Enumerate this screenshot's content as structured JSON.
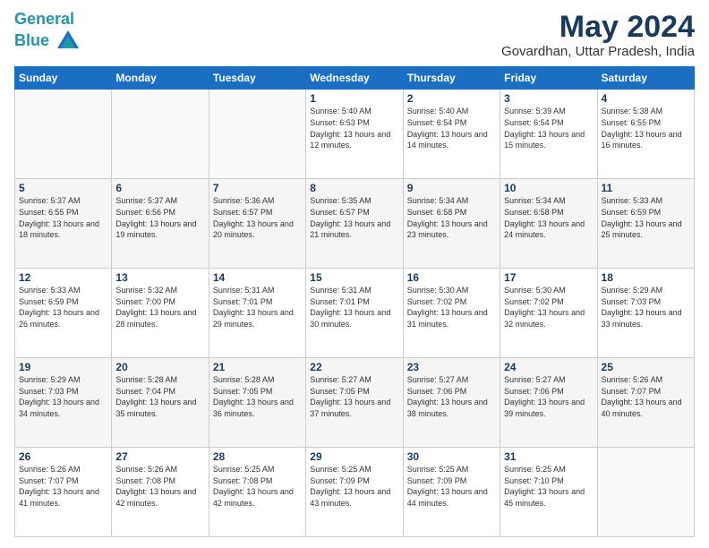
{
  "header": {
    "logo_line1": "General",
    "logo_line2": "Blue",
    "title": "May 2024",
    "subtitle": "Govardhan, Uttar Pradesh, India"
  },
  "weekdays": [
    "Sunday",
    "Monday",
    "Tuesday",
    "Wednesday",
    "Thursday",
    "Friday",
    "Saturday"
  ],
  "weeks": [
    [
      {
        "day": "",
        "info": ""
      },
      {
        "day": "",
        "info": ""
      },
      {
        "day": "",
        "info": ""
      },
      {
        "day": "1",
        "info": "Sunrise: 5:40 AM\nSunset: 6:53 PM\nDaylight: 13 hours and 12 minutes."
      },
      {
        "day": "2",
        "info": "Sunrise: 5:40 AM\nSunset: 6:54 PM\nDaylight: 13 hours and 14 minutes."
      },
      {
        "day": "3",
        "info": "Sunrise: 5:39 AM\nSunset: 6:54 PM\nDaylight: 13 hours and 15 minutes."
      },
      {
        "day": "4",
        "info": "Sunrise: 5:38 AM\nSunset: 6:55 PM\nDaylight: 13 hours and 16 minutes."
      }
    ],
    [
      {
        "day": "5",
        "info": "Sunrise: 5:37 AM\nSunset: 6:55 PM\nDaylight: 13 hours and 18 minutes."
      },
      {
        "day": "6",
        "info": "Sunrise: 5:37 AM\nSunset: 6:56 PM\nDaylight: 13 hours and 19 minutes."
      },
      {
        "day": "7",
        "info": "Sunrise: 5:36 AM\nSunset: 6:57 PM\nDaylight: 13 hours and 20 minutes."
      },
      {
        "day": "8",
        "info": "Sunrise: 5:35 AM\nSunset: 6:57 PM\nDaylight: 13 hours and 21 minutes."
      },
      {
        "day": "9",
        "info": "Sunrise: 5:34 AM\nSunset: 6:58 PM\nDaylight: 13 hours and 23 minutes."
      },
      {
        "day": "10",
        "info": "Sunrise: 5:34 AM\nSunset: 6:58 PM\nDaylight: 13 hours and 24 minutes."
      },
      {
        "day": "11",
        "info": "Sunrise: 5:33 AM\nSunset: 6:59 PM\nDaylight: 13 hours and 25 minutes."
      }
    ],
    [
      {
        "day": "12",
        "info": "Sunrise: 5:33 AM\nSunset: 6:59 PM\nDaylight: 13 hours and 26 minutes."
      },
      {
        "day": "13",
        "info": "Sunrise: 5:32 AM\nSunset: 7:00 PM\nDaylight: 13 hours and 28 minutes."
      },
      {
        "day": "14",
        "info": "Sunrise: 5:31 AM\nSunset: 7:01 PM\nDaylight: 13 hours and 29 minutes."
      },
      {
        "day": "15",
        "info": "Sunrise: 5:31 AM\nSunset: 7:01 PM\nDaylight: 13 hours and 30 minutes."
      },
      {
        "day": "16",
        "info": "Sunrise: 5:30 AM\nSunset: 7:02 PM\nDaylight: 13 hours and 31 minutes."
      },
      {
        "day": "17",
        "info": "Sunrise: 5:30 AM\nSunset: 7:02 PM\nDaylight: 13 hours and 32 minutes."
      },
      {
        "day": "18",
        "info": "Sunrise: 5:29 AM\nSunset: 7:03 PM\nDaylight: 13 hours and 33 minutes."
      }
    ],
    [
      {
        "day": "19",
        "info": "Sunrise: 5:29 AM\nSunset: 7:03 PM\nDaylight: 13 hours and 34 minutes."
      },
      {
        "day": "20",
        "info": "Sunrise: 5:28 AM\nSunset: 7:04 PM\nDaylight: 13 hours and 35 minutes."
      },
      {
        "day": "21",
        "info": "Sunrise: 5:28 AM\nSunset: 7:05 PM\nDaylight: 13 hours and 36 minutes."
      },
      {
        "day": "22",
        "info": "Sunrise: 5:27 AM\nSunset: 7:05 PM\nDaylight: 13 hours and 37 minutes."
      },
      {
        "day": "23",
        "info": "Sunrise: 5:27 AM\nSunset: 7:06 PM\nDaylight: 13 hours and 38 minutes."
      },
      {
        "day": "24",
        "info": "Sunrise: 5:27 AM\nSunset: 7:06 PM\nDaylight: 13 hours and 39 minutes."
      },
      {
        "day": "25",
        "info": "Sunrise: 5:26 AM\nSunset: 7:07 PM\nDaylight: 13 hours and 40 minutes."
      }
    ],
    [
      {
        "day": "26",
        "info": "Sunrise: 5:26 AM\nSunset: 7:07 PM\nDaylight: 13 hours and 41 minutes."
      },
      {
        "day": "27",
        "info": "Sunrise: 5:26 AM\nSunset: 7:08 PM\nDaylight: 13 hours and 42 minutes."
      },
      {
        "day": "28",
        "info": "Sunrise: 5:25 AM\nSunset: 7:08 PM\nDaylight: 13 hours and 42 minutes."
      },
      {
        "day": "29",
        "info": "Sunrise: 5:25 AM\nSunset: 7:09 PM\nDaylight: 13 hours and 43 minutes."
      },
      {
        "day": "30",
        "info": "Sunrise: 5:25 AM\nSunset: 7:09 PM\nDaylight: 13 hours and 44 minutes."
      },
      {
        "day": "31",
        "info": "Sunrise: 5:25 AM\nSunset: 7:10 PM\nDaylight: 13 hours and 45 minutes."
      },
      {
        "day": "",
        "info": ""
      }
    ]
  ]
}
